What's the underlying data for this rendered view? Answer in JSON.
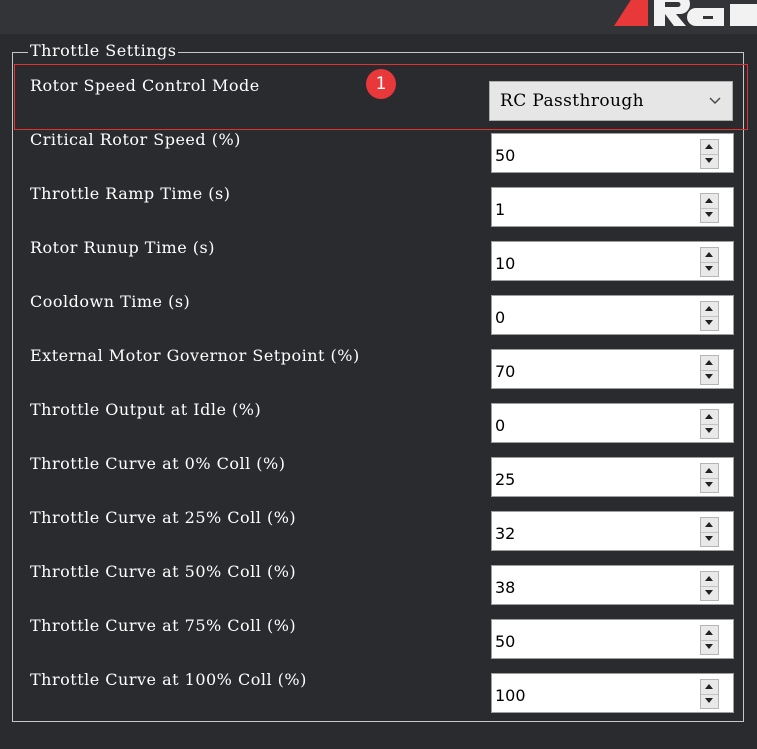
{
  "group": {
    "title": "Throttle Settings"
  },
  "badge": "1",
  "rotor_speed_mode": {
    "label": "Rotor Speed Control Mode",
    "value": "RC Passthrough"
  },
  "fields": [
    {
      "label": "Critical Rotor Speed (%)",
      "value": "50"
    },
    {
      "label": "Throttle Ramp Time (s)",
      "value": "1"
    },
    {
      "label": "Rotor Runup Time (s)",
      "value": "10"
    },
    {
      "label": "Cooldown Time (s)",
      "value": "0"
    },
    {
      "label": "External Motor Governor Setpoint (%)",
      "value": "70"
    },
    {
      "label": "Throttle Output at Idle (%)",
      "value": "0"
    },
    {
      "label": "Throttle Curve at 0% Coll (%)",
      "value": "25"
    },
    {
      "label": "Throttle Curve at 25% Coll (%)",
      "value": "32"
    },
    {
      "label": "Throttle Curve at 50% Coll (%)",
      "value": "38"
    },
    {
      "label": "Throttle Curve at 75% Coll (%)",
      "value": "50"
    },
    {
      "label": "Throttle Curve at 100% Coll (%)",
      "value": "100"
    }
  ]
}
